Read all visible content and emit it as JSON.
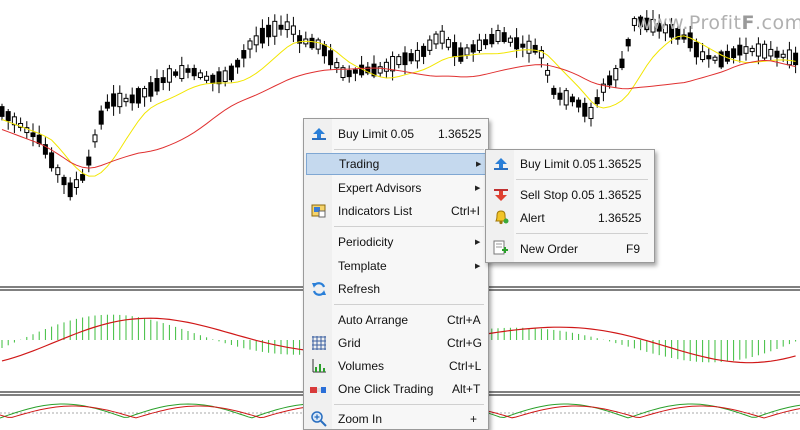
{
  "watermark": {
    "text": "www.Profit",
    "accent": "F",
    "suffix": ".com"
  },
  "colors": {
    "candle": "#000000",
    "ma_fast": "#f2e600",
    "ma_slow": "#e03030",
    "macd_hist": "#3cbe3c",
    "macd_signal": "#d01818",
    "menu_highlight": "#c5d9ee"
  },
  "context_menu": {
    "items": [
      {
        "label": "Buy Limit 0.05",
        "value": "1.36525",
        "icon": "arrow-up-icon"
      },
      {
        "label": "Trading",
        "submenu": true,
        "highlighted": true
      },
      {
        "label": "Expert Advisors",
        "submenu": true
      },
      {
        "label": "Indicators List",
        "value": "Ctrl+I",
        "icon": "indicators-list-icon"
      },
      {
        "label": "Periodicity",
        "submenu": true
      },
      {
        "label": "Template",
        "submenu": true
      },
      {
        "label": "Refresh",
        "icon": "refresh-icon"
      },
      {
        "label": "Auto Arrange",
        "value": "Ctrl+A"
      },
      {
        "label": "Grid",
        "value": "Ctrl+G",
        "icon": "grid-icon"
      },
      {
        "label": "Volumes",
        "value": "Ctrl+L",
        "icon": "volumes-icon"
      },
      {
        "label": "One Click Trading",
        "value": "Alt+T",
        "icon": "one-click-trading-icon"
      },
      {
        "label": "Zoom In",
        "value": "+",
        "icon": "zoom-in-icon"
      }
    ]
  },
  "trading_submenu": {
    "items": [
      {
        "label": "Buy Limit 0.05",
        "value": "1.36525",
        "icon": "arrow-up-icon"
      },
      {
        "label": "Sell Stop 0.05",
        "value": "1.36525",
        "icon": "arrow-down-icon"
      },
      {
        "label": "Alert",
        "value": "1.36525",
        "icon": "bell-icon"
      },
      {
        "label": "New Order",
        "value": "F9",
        "icon": "new-order-icon"
      }
    ]
  }
}
